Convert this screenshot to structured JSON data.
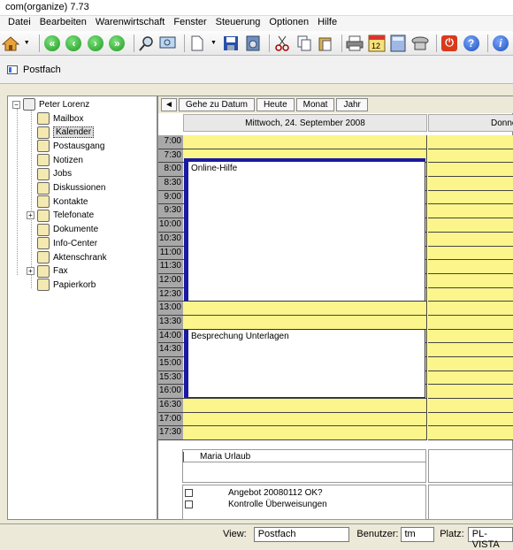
{
  "window": {
    "title": "com(organize) 7.73"
  },
  "menu": [
    "Datei",
    "Bearbeiten",
    "Warenwirtschaft",
    "Fenster",
    "Steuerung",
    "Optionen",
    "Hilfe"
  ],
  "mode": {
    "label": "Postfach"
  },
  "tree": {
    "root": "Peter Lorenz",
    "items": [
      {
        "label": "Mailbox",
        "icon": "mailbox-icon"
      },
      {
        "label": "Kalender",
        "icon": "calendar-icon",
        "selected": true
      },
      {
        "label": "Postausgang",
        "icon": "outbox-icon"
      },
      {
        "label": "Notizen",
        "icon": "notes-icon"
      },
      {
        "label": "Jobs",
        "icon": "jobs-icon"
      },
      {
        "label": "Diskussionen",
        "icon": "discussions-icon"
      },
      {
        "label": "Kontakte",
        "icon": "contacts-icon"
      },
      {
        "label": "Telefonate",
        "icon": "phone-icon",
        "expandable": true
      },
      {
        "label": "Dokumente",
        "icon": "folder-icon"
      },
      {
        "label": "Info-Center",
        "icon": "magnifier-icon"
      },
      {
        "label": "Aktenschrank",
        "icon": "cabinet-icon"
      },
      {
        "label": "Fax",
        "icon": "fax-icon",
        "expandable": true
      },
      {
        "label": "Papierkorb",
        "icon": "trash-icon"
      }
    ]
  },
  "calendar": {
    "buttons": [
      "Gehe zu Datum",
      "Heute",
      "Monat",
      "Jahr"
    ],
    "nav_arrow": "◄",
    "day_header": "Mittwoch, 24. September 2008",
    "next_day_header": "Donne",
    "times": [
      "7:00",
      "7:30",
      "8:00",
      "8:30",
      "9:00",
      "9:30",
      "10:00",
      "10:30",
      "11:00",
      "11:30",
      "12:00",
      "12:30",
      "13:00",
      "13:30",
      "14:00",
      "14:30",
      "15:00",
      "15:30",
      "16:00",
      "16:30",
      "17:00",
      "17:30"
    ],
    "appointments": [
      {
        "title": "Online-Hilfe"
      },
      {
        "title": "Besprechung Unterlagen"
      }
    ],
    "all_day": "Maria Urlaub",
    "tasks": [
      "Angebot 20080112 OK?",
      "Kontrolle Überweisungen"
    ]
  },
  "status": {
    "view_label": "View:",
    "view_value": "Postfach",
    "user_label": "Benutzer:",
    "user_value": "tm",
    "place_label": "Platz:",
    "place_value": "PL-VISTA"
  },
  "colors": {
    "slot": "#fbf58c",
    "time_col": "#a8a8a8",
    "appt_bar": "#1a1aa3"
  }
}
